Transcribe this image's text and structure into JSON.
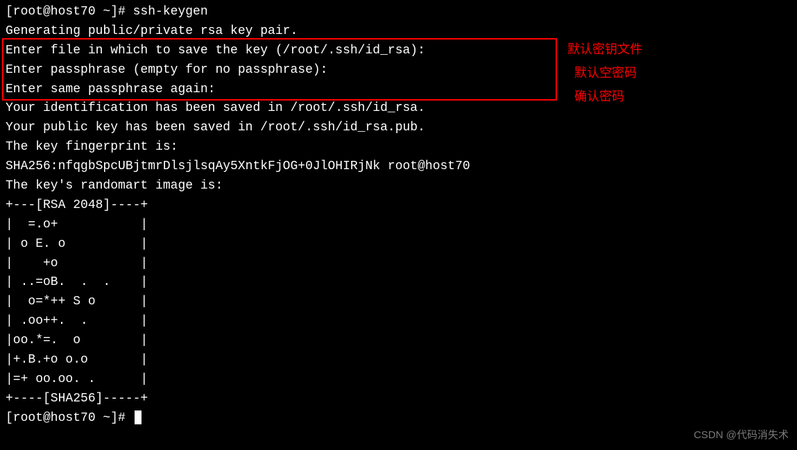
{
  "terminal": {
    "prompt1": "[root@host70 ~]# ssh-keygen",
    "line_generating": "Generating public/private rsa key pair.",
    "line_enter_file": "Enter file in which to save the key (/root/.ssh/id_rsa):",
    "line_enter_pass": "Enter passphrase (empty for no passphrase):",
    "line_enter_pass_again": "Enter same passphrase again:",
    "line_id_saved": "Your identification has been saved in /root/.ssh/id_rsa.",
    "line_pub_saved": "Your public key has been saved in /root/.ssh/id_rsa.pub.",
    "line_fingerprint_is": "The key fingerprint is:",
    "line_fingerprint_val": "SHA256:nfqgbSpcUBjtmrDlsjlsqAy5XntkFjOG+0JlOHIRjNk root@host70",
    "line_randomart_is": "The key's randomart image is:",
    "randomart_top": "+---[RSA 2048]----+",
    "randomart_01": "|  =.o+           |",
    "randomart_02": "| o E. o          |",
    "randomart_03": "|    +o           |",
    "randomart_04": "| ..=oB.  .  .    |",
    "randomart_05": "|  o=*++ S o      |",
    "randomart_06": "| .oo++.  .       |",
    "randomart_07": "|oo.*=.  o        |",
    "randomart_08": "|+.B.+o o.o       |",
    "randomart_09": "|=+ oo.oo. .      |",
    "randomart_bottom": "+----[SHA256]-----+",
    "prompt2": "[root@host70 ~]# "
  },
  "annotations": {
    "ann1": "默认密钥文件",
    "ann2": "默认空密码",
    "ann3": "确认密码"
  },
  "watermark": "CSDN @代码消失术"
}
